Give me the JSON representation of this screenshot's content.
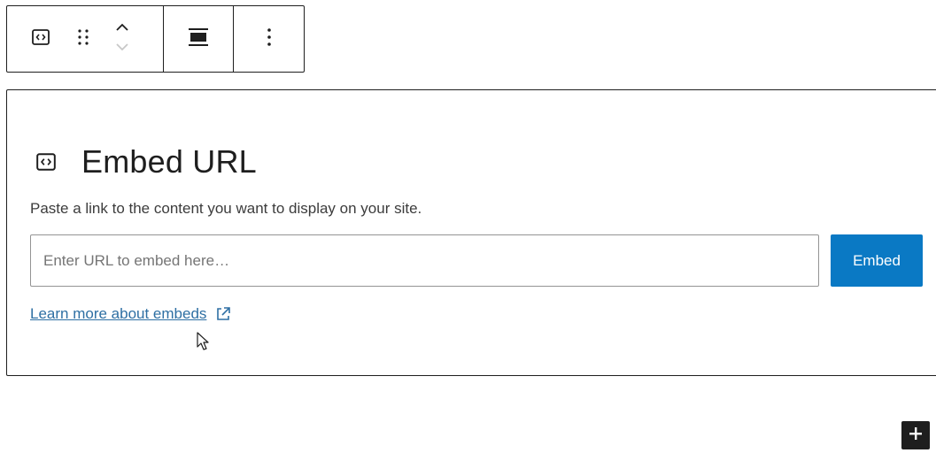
{
  "toolbar": {
    "icons": {
      "block_type": "embed-icon",
      "drag": "drag-handle-icon",
      "move_up": "chevron-up-icon",
      "move_down": "chevron-down-icon",
      "align": "align-wide-icon",
      "options": "more-vertical-icon"
    }
  },
  "embed": {
    "title": "Embed URL",
    "instructions": "Paste a link to the content you want to display on your site.",
    "input_placeholder": "Enter URL to embed here…",
    "input_value": "",
    "submit_label": "Embed",
    "learn_more_label": "Learn more about embeds",
    "icons": {
      "title": "embed-icon",
      "learn_more": "external-link-icon"
    }
  },
  "inserter": {
    "icon": "plus-icon"
  },
  "colors": {
    "primary": "#0a79c4",
    "link": "#2e6fa3",
    "border": "#1e1e1e",
    "input_border": "#949494"
  }
}
